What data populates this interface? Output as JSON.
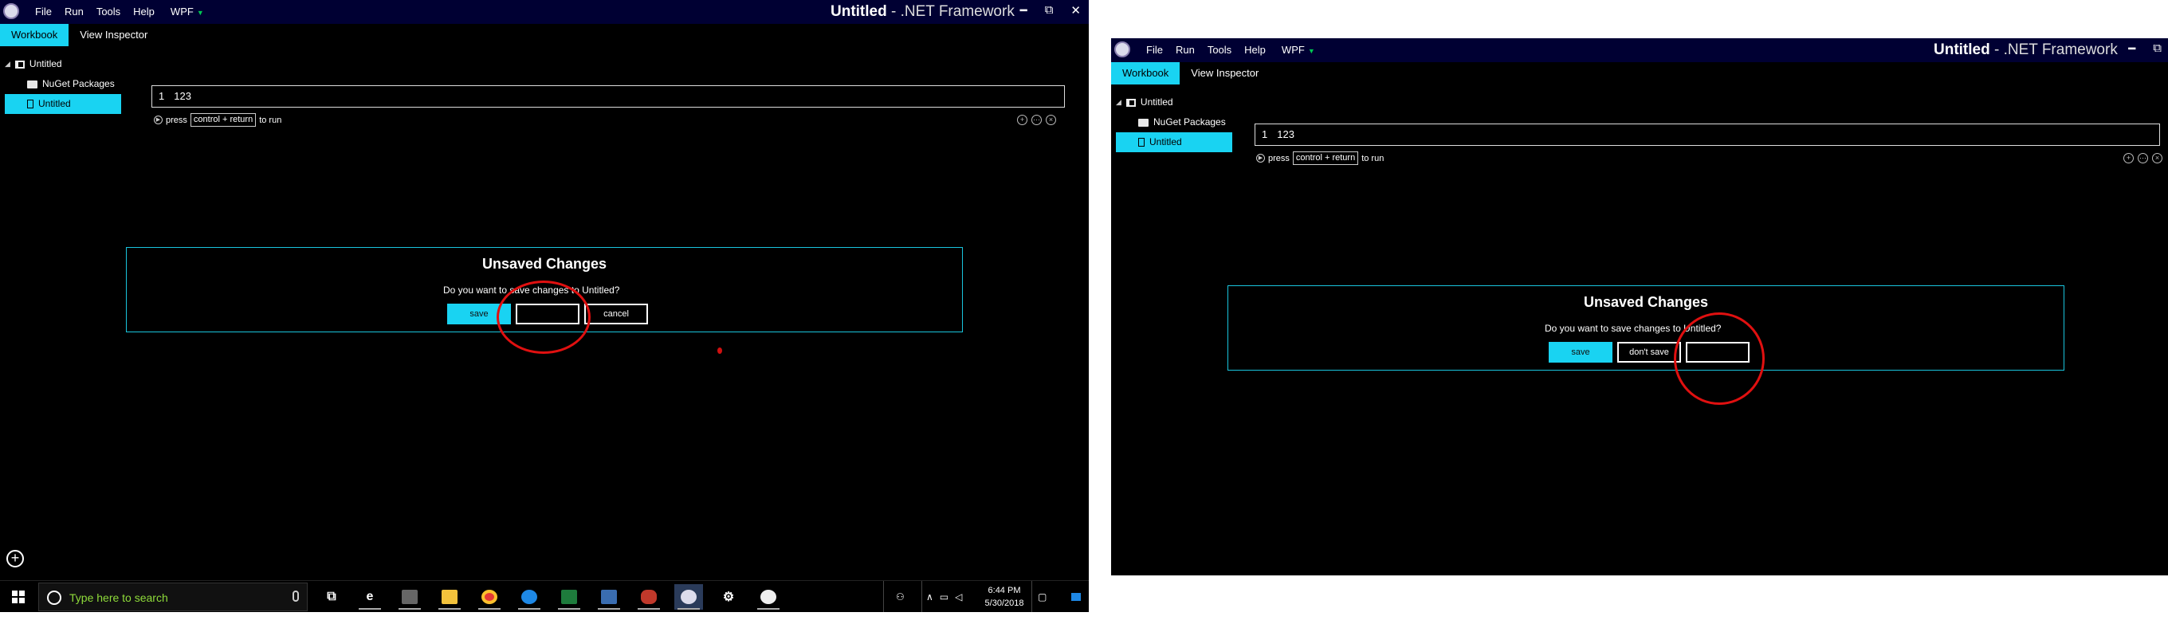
{
  "app": {
    "document_title": "Untitled",
    "framework_title": " - .NET Framework",
    "menu": [
      "File",
      "Run",
      "Tools",
      "Help"
    ],
    "target": "WPF"
  },
  "tabs": [
    "Workbook",
    "View Inspector"
  ],
  "tree": {
    "root": "Untitled",
    "folder": "NuGet Packages",
    "file": "Untitled"
  },
  "editor": {
    "line_number": "1",
    "code": "123",
    "hint_prefix": "press",
    "hint_key": "control + return",
    "hint_suffix": "to run"
  },
  "dialog_left": {
    "title": "Unsaved Changes",
    "message": "Do you want to save changes to Untitled?",
    "buttons": [
      "save",
      "",
      "cancel"
    ]
  },
  "dialog_right": {
    "title": "Unsaved Changes",
    "message": "Do you want to save changes to Untitled?",
    "buttons": [
      "save",
      "don't save",
      ""
    ]
  },
  "taskbar": {
    "search_placeholder": "Type here to search",
    "time": "6:44 PM",
    "date": "5/30/2018",
    "apps": [
      "task-view",
      "edge",
      "calculator",
      "file-explorer",
      "chrome",
      "skype",
      "excel",
      "network-tool",
      "paint",
      "workbooks",
      "settings",
      "app-circle"
    ]
  },
  "colors": {
    "accent": "#19d3f2",
    "titlebar": "#000033",
    "annotation": "#e01010",
    "dialog_border": "#19c5dd"
  }
}
